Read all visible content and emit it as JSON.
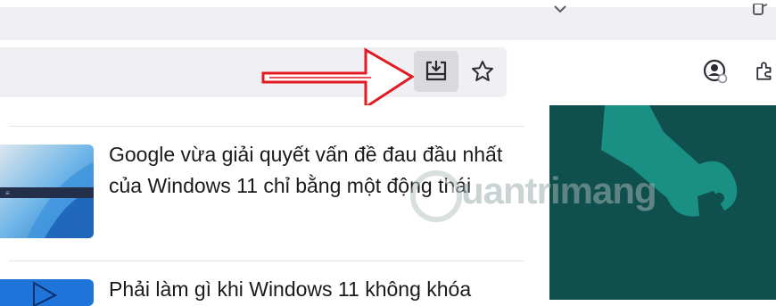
{
  "colors": {
    "tab_strip_bg": "#f0f0f4",
    "url_bar_bg": "#f0f0f4",
    "save_button_active_bg": "#dadade",
    "annotation_arrow": "#e21b23",
    "side_panel_bg": "#0f4f4d",
    "wrench_logo": "#1a8f84"
  },
  "toolbar": {
    "icons": [
      "save-page-icon",
      "bookmark-star-icon",
      "account-icon",
      "extensions-icon"
    ]
  },
  "articles": [
    {
      "title": "Google vừa giải quyết vấn đề đau đầu nhất của Windows 11 chỉ bằng một động thái",
      "thumb": "windows-11-wallpaper"
    },
    {
      "title": "Phải làm gì khi Windows 11 không khóa",
      "thumb": "windows-11-wallpaper"
    }
  ],
  "watermark": {
    "text": "uantrimang"
  }
}
